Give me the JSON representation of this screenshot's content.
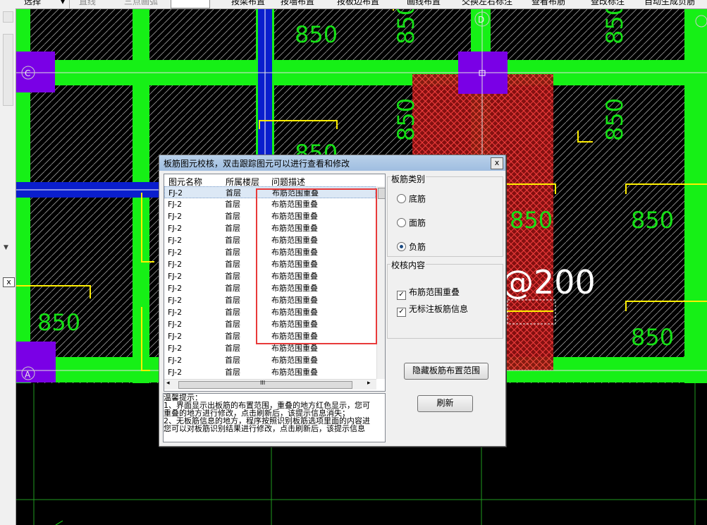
{
  "toolbar": {
    "items": [
      "选择",
      "直线",
      "三点画弧",
      "按梁布置",
      "按墙布置",
      "按板边布置",
      "画线布置",
      "交换左右标注",
      "查看布筋",
      "查改标注",
      "自动生成负筋"
    ]
  },
  "left_panel": {
    "close_label": "x"
  },
  "cad": {
    "labels_850": [
      "850",
      "850",
      "850",
      "850",
      "850",
      "850",
      "850",
      "850",
      "850",
      "850"
    ],
    "spacing_text": "@200",
    "axis_labels": [
      "C",
      "A",
      "D"
    ]
  },
  "dialog": {
    "title": "板筋图元校核，双击跟踪图元可以进行查看和修改",
    "close_label": "x",
    "columns": [
      "图元名称",
      "所属楼层",
      "问题描述"
    ],
    "rows": [
      {
        "name": "FJ-2",
        "floor": "首层",
        "issue": "布筋范围重叠"
      },
      {
        "name": "FJ-2",
        "floor": "首层",
        "issue": "布筋范围重叠"
      },
      {
        "name": "FJ-2",
        "floor": "首层",
        "issue": "布筋范围重叠"
      },
      {
        "name": "FJ-2",
        "floor": "首层",
        "issue": "布筋范围重叠"
      },
      {
        "name": "FJ-2",
        "floor": "首层",
        "issue": "布筋范围重叠"
      },
      {
        "name": "FJ-2",
        "floor": "首层",
        "issue": "布筋范围重叠"
      },
      {
        "name": "FJ-2",
        "floor": "首层",
        "issue": "布筋范围重叠"
      },
      {
        "name": "FJ-2",
        "floor": "首层",
        "issue": "布筋范围重叠"
      },
      {
        "name": "FJ-2",
        "floor": "首层",
        "issue": "布筋范围重叠"
      },
      {
        "name": "FJ-2",
        "floor": "首层",
        "issue": "布筋范围重叠"
      },
      {
        "name": "FJ-2",
        "floor": "首层",
        "issue": "布筋范围重叠"
      },
      {
        "name": "FJ-2",
        "floor": "首层",
        "issue": "布筋范围重叠"
      },
      {
        "name": "FJ-2",
        "floor": "首层",
        "issue": "布筋范围重叠"
      },
      {
        "name": "FJ-2",
        "floor": "首层",
        "issue": "布筋范围重叠"
      },
      {
        "name": "FJ-2",
        "floor": "首层",
        "issue": "布筋范围重叠"
      },
      {
        "name": "FJ-2",
        "floor": "首层",
        "issue": "布筋范围重叠"
      }
    ],
    "hscroll_glyph": "III",
    "tips": [
      "温馨提示：",
      "1、界面显示出板筋的布置范围，重叠的地方红色显示，您可",
      "重叠的地方进行修改，点击刷新后，该提示信息消失；",
      "2、无板筋信息的地方，程序按照识别板筋选项里面的内容进",
      "您可以对板筋识别结果进行修改，点击刷新后，该提示信息"
    ],
    "rebar_type": {
      "label": "板筋类别",
      "options": [
        "底筋",
        "面筋",
        "负筋"
      ],
      "selected": "负筋"
    },
    "check_content": {
      "label": "校核内容",
      "items": [
        {
          "label": "布筋范围重叠",
          "checked": true
        },
        {
          "label": "无标注板筋信息",
          "checked": true
        }
      ]
    },
    "hide_button": "隐藏板筋布置范围",
    "refresh_button": "刷新"
  },
  "colors": {
    "beam": "#16f016",
    "column": "#7a00e6",
    "wall": "#0a1ecd",
    "rebar": "#ffee00",
    "overlap": "#cc0000",
    "selection_box": "#e83a3a"
  }
}
